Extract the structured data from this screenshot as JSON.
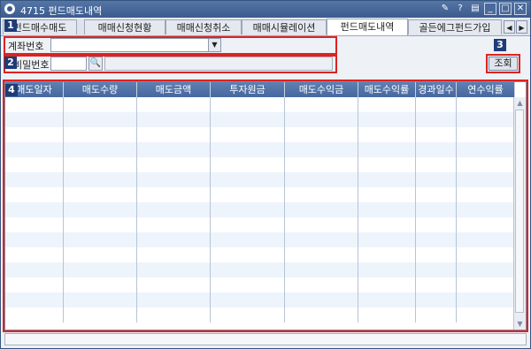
{
  "window": {
    "title": "4715 펀드매도내역"
  },
  "title_controls": [
    "pin-icon",
    "help-icon",
    "menu-icon",
    "minimize-icon",
    "maximize-icon",
    "close-icon"
  ],
  "tabs": [
    {
      "label": "펀드매수매도",
      "active": false
    },
    {
      "label": "매매신청현황",
      "active": false
    },
    {
      "label": "매매신청취소",
      "active": false
    },
    {
      "label": "매매시뮬레이션",
      "active": false
    },
    {
      "label": "펀드매도내역",
      "active": true
    },
    {
      "label": "골든에그펀드가입",
      "active": false
    }
  ],
  "form": {
    "account_label": "계좌번호",
    "account_value": "",
    "password_label": "비밀번호",
    "password_value": "",
    "account_name": ""
  },
  "buttons": {
    "query": "조회"
  },
  "markers": [
    "1",
    "2",
    "3",
    "4"
  ],
  "grid": {
    "columns": [
      "매도일자",
      "매도수량",
      "매도금액",
      "투자원금",
      "매도수익금",
      "매도수익률",
      "경과일수",
      "연수익률"
    ],
    "rows": [],
    "empty_rows": 15
  },
  "colors": {
    "header": "#4a6ca3",
    "highlight": "#dd2222",
    "marker": "#1e3c78"
  }
}
